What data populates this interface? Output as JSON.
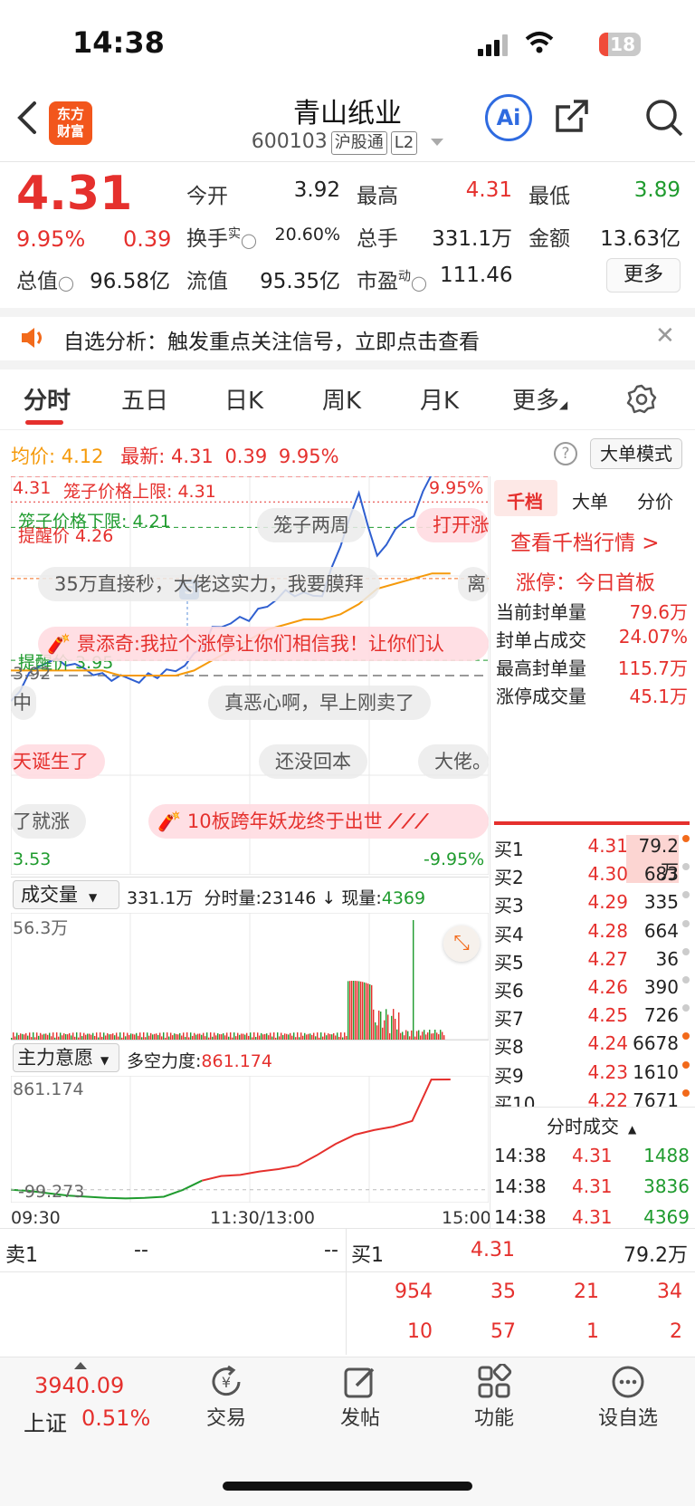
{
  "status_bar": {
    "time": "14:38",
    "battery": "18"
  },
  "nav": {
    "title": "青山纸业",
    "code": "600103",
    "tag1": "沪股通",
    "tag2": "L2",
    "logo_line1": "东方",
    "logo_line2": "财富",
    "ai_label": "Ai"
  },
  "quote": {
    "price": "4.31",
    "change_pct": "9.95%",
    "change": "0.39",
    "open_label": "今开",
    "open": "3.92",
    "high_label": "最高",
    "high": "4.31",
    "low_label": "最低",
    "low": "3.89",
    "turnover_label": "换手",
    "turnover_sup": "实",
    "turnover": "20.60%",
    "volume_label": "总手",
    "volume": "331.1万",
    "amount_label": "金额",
    "amount": "13.63亿",
    "mktcap_label": "总值",
    "mktcap": "96.58亿",
    "float_label": "流值",
    "float_cap": "95.35亿",
    "pe_label": "市盈",
    "pe_sup": "动",
    "pe": "111.46",
    "more_button": "更多"
  },
  "notice": {
    "text": "自选分析：触发重点关注信号，立即点击查看"
  },
  "tabs": [
    "分时",
    "五日",
    "日K",
    "周K",
    "月K",
    "更多"
  ],
  "chart_header": {
    "avg_label": "均价:",
    "avg": "4.12",
    "last_label": "最新:",
    "last": "4.31",
    "change": "0.39",
    "pct": "9.95%",
    "mode_button": "大单模式"
  },
  "chart_labels": {
    "top_price": "4.31",
    "top_pct": "9.95%",
    "upper_limit": "笼子价格上限: 4.31",
    "lower_limit": "笼子价格下限: 4.21",
    "alert1": "提醒价 4.26",
    "alert2": "提醒价 3.95",
    "prev_close": "3.92",
    "bottom_price": "3.53",
    "bottom_pct": "-9.95%",
    "s_marker": "S"
  },
  "danmu": [
    "笼子两周",
    "打开涨",
    "35万直接秒，大佬这实力，我要膜拜",
    "离",
    "景添奇:我拉个涨停让你们相信我！让你们认",
    "真恶心啊，早上刚卖了",
    "中",
    "天诞生了",
    "还没回本",
    "大佬。",
    "了就涨",
    "10板跨年妖龙终于出世"
  ],
  "volume_panel": {
    "selector": "成交量",
    "total": "331.1万",
    "tick_label": "分时量:",
    "tick": "23146",
    "arrow": "↓",
    "cur_label": "现量:",
    "cur": "4369",
    "max": "56.3万"
  },
  "force_panel": {
    "selector": "主力意愿",
    "label": "多空力度:",
    "value": "861.174",
    "max": "861.174",
    "min": "-99.273"
  },
  "time_axis": {
    "start": "09:30",
    "mid": "11:30/13:00",
    "end": "15:00"
  },
  "right_tabs": [
    "千档",
    "大单",
    "分价"
  ],
  "right_panel": {
    "link": "查看千档行情 >",
    "limit_title": "涨停：今日首板",
    "rows": [
      [
        "当前封单量",
        "79.6万"
      ],
      [
        "封单占成交",
        "24.07%"
      ],
      [
        "最高封单量",
        "115.7万"
      ],
      [
        "涨停成交量",
        "45.1万"
      ]
    ]
  },
  "order_book": [
    [
      "买1",
      "4.31",
      "79.2万"
    ],
    [
      "买2",
      "4.30",
      "683"
    ],
    [
      "买3",
      "4.29",
      "335"
    ],
    [
      "买4",
      "4.28",
      "664"
    ],
    [
      "买5",
      "4.27",
      "36"
    ],
    [
      "买6",
      "4.26",
      "390"
    ],
    [
      "买7",
      "4.25",
      "726"
    ],
    [
      "买8",
      "4.24",
      "6678"
    ],
    [
      "买9",
      "4.23",
      "1610"
    ],
    [
      "买10",
      "4.22",
      "7671"
    ]
  ],
  "ticks_header": "分时成交",
  "ticks": [
    [
      "14:38",
      "4.31",
      "1488"
    ],
    [
      "14:38",
      "4.31",
      "3836"
    ],
    [
      "14:38",
      "4.31",
      "4369"
    ]
  ],
  "level1": {
    "sell_label": "卖1",
    "sell_price": "--",
    "sell_vol": "--",
    "buy_label": "买1",
    "buy_price": "4.31",
    "buy_vol": "79.2万",
    "queue_row1": [
      "954",
      "35",
      "21",
      "34"
    ],
    "queue_row2": [
      "10",
      "57",
      "1",
      "2"
    ]
  },
  "bottom_bar": {
    "index_value": "3940.09",
    "index_name": "上证",
    "index_pct": "0.51%",
    "items": [
      "交易",
      "发帖",
      "功能",
      "设自选"
    ]
  },
  "colors": {
    "up": "#e5302d",
    "down": "#1f9b2e",
    "avg_line": "#f59a0b",
    "price_line": "#2f5fd0"
  },
  "chart_data": {
    "type": "line",
    "x_range": [
      "09:30",
      "15:00"
    ],
    "ylim": [
      3.53,
      4.31
    ],
    "series": [
      {
        "name": "最新",
        "values": [
          3.87,
          3.93,
          3.95,
          3.94,
          3.93,
          3.92,
          3.92,
          3.91,
          3.92,
          3.93,
          3.96,
          4.01,
          4.02,
          4.03,
          4.06,
          4.09,
          4.08,
          4.07,
          4.17,
          4.28,
          4.16,
          4.21,
          4.23,
          4.31,
          4.31
        ]
      },
      {
        "name": "均价",
        "values": [
          3.93,
          3.93,
          3.93,
          3.93,
          3.93,
          3.93,
          3.92,
          3.92,
          3.92,
          3.92,
          3.93,
          3.95,
          3.97,
          3.99,
          4.01,
          4.02,
          4.03,
          4.03,
          4.04,
          4.06,
          4.09,
          4.1,
          4.11,
          4.12,
          4.12
        ]
      }
    ],
    "volume_max": "56.3万",
    "force": {
      "values": [
        -99.273,
        -110,
        -130,
        -150,
        -160,
        -170,
        -175,
        -170,
        -160,
        -100,
        -20,
        20,
        30,
        60,
        80,
        110,
        200,
        300,
        380,
        420,
        450,
        500,
        860,
        861.174
      ]
    }
  }
}
